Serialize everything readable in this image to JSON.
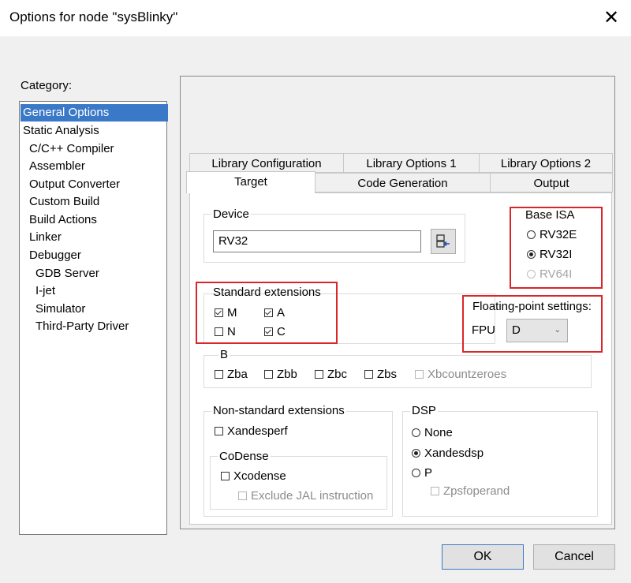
{
  "window": {
    "title": "Options for node \"sysBlinky\"",
    "close_glyph": "✕"
  },
  "category": {
    "label": "Category:",
    "items": [
      "General Options",
      "Static Analysis",
      "C/C++ Compiler",
      "Assembler",
      "Output Converter",
      "Custom Build",
      "Build Actions",
      "Linker",
      "Debugger",
      "GDB Server",
      "I-jet",
      "Simulator",
      "Third-Party Driver"
    ],
    "selected": "General Options"
  },
  "tabs": {
    "row1": [
      "Library Configuration",
      "Library Options 1",
      "Library Options 2"
    ],
    "row2": [
      "Target",
      "Code Generation",
      "Output"
    ],
    "active": "Target"
  },
  "device": {
    "label": "Device",
    "value": "RV32"
  },
  "base_isa": {
    "label": "Base ISA",
    "options": [
      {
        "label": "RV32E",
        "checked": false,
        "disabled": false
      },
      {
        "label": "RV32I",
        "checked": true,
        "disabled": false
      },
      {
        "label": "RV64I",
        "checked": false,
        "disabled": true
      }
    ]
  },
  "standard_extensions": {
    "label": "Standard extensions",
    "options": [
      {
        "label": "M",
        "checked": true
      },
      {
        "label": "A",
        "checked": true
      },
      {
        "label": "N",
        "checked": false
      },
      {
        "label": "C",
        "checked": true
      }
    ]
  },
  "floating_point": {
    "label": "Floating-point settings:",
    "fpu_label": "FPU",
    "fpu_value": "D"
  },
  "b_ext": {
    "label": "B",
    "options": [
      {
        "label": "Zba",
        "checked": false,
        "disabled": false
      },
      {
        "label": "Zbb",
        "checked": false,
        "disabled": false
      },
      {
        "label": "Zbc",
        "checked": false,
        "disabled": false
      },
      {
        "label": "Zbs",
        "checked": false,
        "disabled": false
      },
      {
        "label": "Xbcountzeroes",
        "checked": false,
        "disabled": true
      }
    ]
  },
  "nonstandard": {
    "label": "Non-standard extensions",
    "xandesperf": "Xandesperf",
    "codense": {
      "label": "CoDense",
      "xcodense": "Xcodense",
      "exclude_jal": "Exclude JAL instruction"
    }
  },
  "dsp": {
    "label": "DSP",
    "options": [
      {
        "label": "None",
        "checked": false
      },
      {
        "label": "Xandesdsp",
        "checked": true
      },
      {
        "label": "P",
        "checked": false
      }
    ],
    "zpsfoperand": "Zpsfoperand"
  },
  "buttons": {
    "ok": "OK",
    "cancel": "Cancel"
  }
}
